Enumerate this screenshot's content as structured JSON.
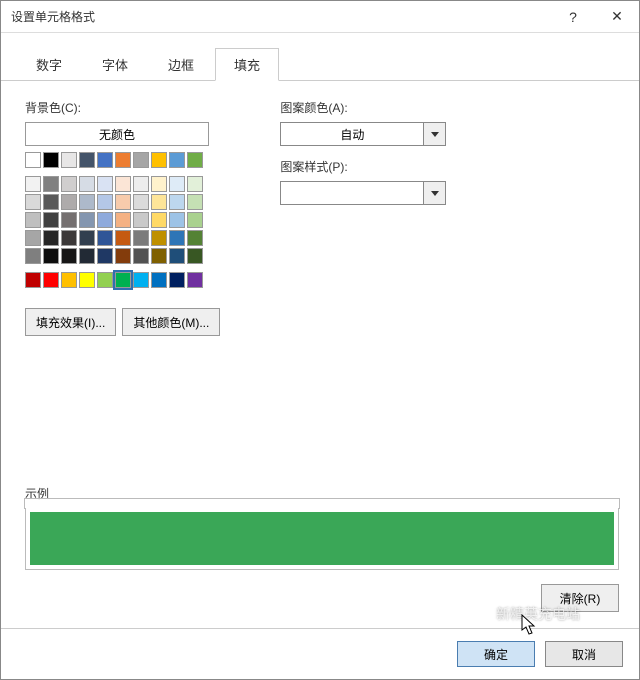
{
  "window": {
    "title": "设置单元格格式"
  },
  "tabs": {
    "items": [
      "数字",
      "字体",
      "边框",
      "填充"
    ],
    "active_index": 3
  },
  "fill": {
    "bg_label": "背景色(C):",
    "no_color": "无颜色",
    "theme_row": [
      "#ffffff",
      "#000000",
      "#e7e6e6",
      "#44546a",
      "#4472c4",
      "#ed7d31",
      "#a5a5a5",
      "#ffc000",
      "#5b9bd5",
      "#70ad47"
    ],
    "shade_grid": [
      [
        "#f2f2f2",
        "#808080",
        "#d0cece",
        "#d6dce5",
        "#d9e2f3",
        "#fbe5d6",
        "#ededed",
        "#fff2cc",
        "#deebf7",
        "#e2f0d9"
      ],
      [
        "#d9d9d9",
        "#595959",
        "#aeabab",
        "#adb9ca",
        "#b4c7e7",
        "#f7cbac",
        "#dbdbdb",
        "#fee599",
        "#bdd7ee",
        "#c5e0b4"
      ],
      [
        "#bfbfbf",
        "#404040",
        "#757070",
        "#8496b0",
        "#8faadc",
        "#f4b183",
        "#c9c9c9",
        "#ffd965",
        "#9dc3e6",
        "#a9d18e"
      ],
      [
        "#a6a6a6",
        "#262626",
        "#3b3838",
        "#323f4f",
        "#2f5597",
        "#c55a11",
        "#7b7b7b",
        "#bf9000",
        "#2e75b6",
        "#548235"
      ],
      [
        "#7f7f7f",
        "#0d0d0d",
        "#171616",
        "#222a35",
        "#1f3864",
        "#833c0c",
        "#525252",
        "#7f6000",
        "#1f4e79",
        "#385723"
      ]
    ],
    "standard_row": [
      "#c00000",
      "#ff0000",
      "#ffc000",
      "#ffff00",
      "#92d050",
      "#00b050",
      "#00b0f0",
      "#0070c0",
      "#002060",
      "#7030a0"
    ],
    "selected_color": "#00b050",
    "effects_btn": "填充效果(I)...",
    "more_colors_btn": "其他颜色(M)..."
  },
  "pattern": {
    "color_label": "图案颜色(A):",
    "color_value": "自动",
    "style_label": "图案样式(P):",
    "style_value": ""
  },
  "sample": {
    "label": "示例",
    "color": "#3aa757"
  },
  "actions": {
    "clear": "清除(R)",
    "ok": "确定",
    "cancel": "取消"
  },
  "watermark": "新精英充电站"
}
